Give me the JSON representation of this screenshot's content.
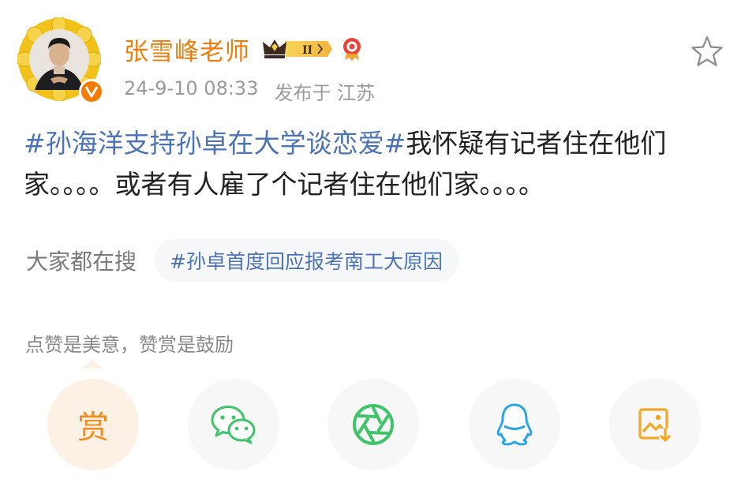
{
  "post": {
    "author": {
      "name": "张雪峰老师",
      "avatar_icon": "avatar-photo",
      "badges": {
        "vip_icon": "crown-vip-badge",
        "vip_level": "II",
        "flame_icon": "flame-badge"
      },
      "verified_icon": "verified-v-badge"
    },
    "timestamp": "24-9-10 08:33",
    "location": "发布于 江苏",
    "favorite_icon": "star-outline-icon",
    "hashtag": "#孙海洋支持孙卓在大学谈恋爱#",
    "body": "我怀疑有记者住在他们家。。。。或者有人雇了个记者住在他们家。。。。"
  },
  "trending": {
    "label": "大家都在搜",
    "chip": "#孙卓首度回应报考南工大原因"
  },
  "reward": {
    "prompt": "点赞是美意，赞赏是鼓励"
  },
  "share": {
    "reward_label": "赏",
    "buttons": [
      {
        "icon": "reward-icon"
      },
      {
        "icon": "wechat-icon"
      },
      {
        "icon": "moments-icon"
      },
      {
        "icon": "qq-icon"
      },
      {
        "icon": "save-image-icon"
      }
    ]
  },
  "colors": {
    "username": "#ef7d0d",
    "hashtag": "#4b73b6",
    "meta": "#9a9a9a",
    "wechat": "#3fc46a",
    "qq": "#2aa6e8",
    "reward": "#f28a1c"
  }
}
